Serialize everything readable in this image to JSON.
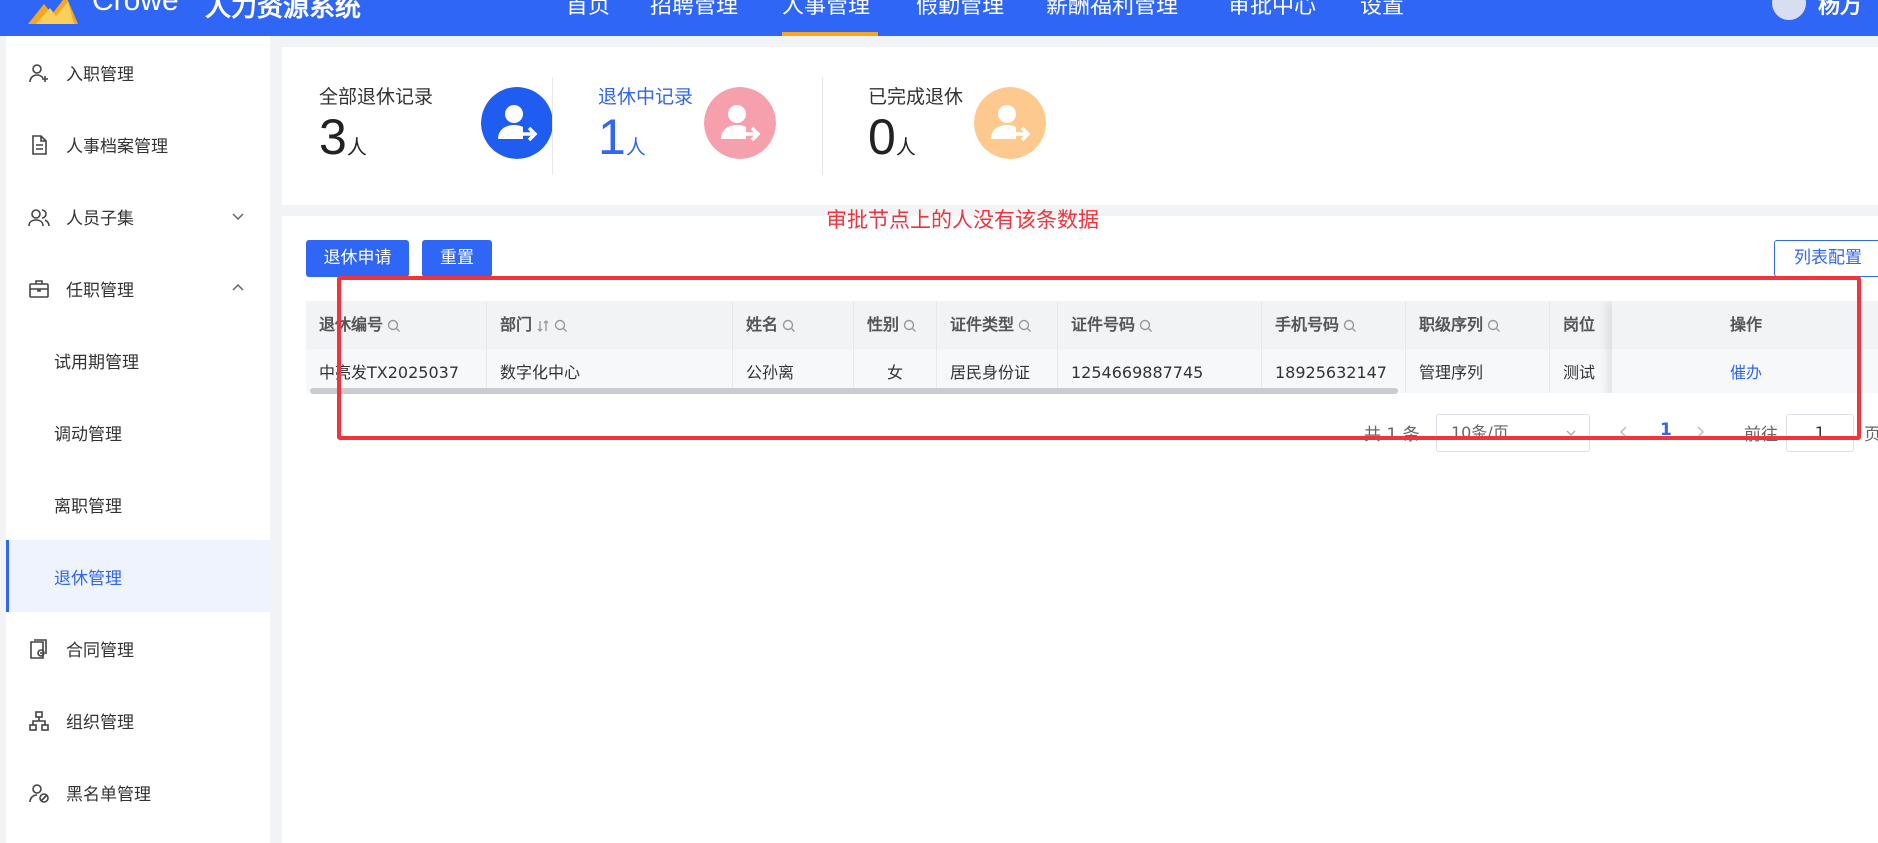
{
  "app": {
    "brand": "Crowe",
    "title": "人力资源系统"
  },
  "topnav": {
    "items": [
      "首页",
      "招聘管理",
      "人事管理",
      "假勤管理",
      "薪酬福利管理",
      "审批中心",
      "设置"
    ],
    "active": "人事管理",
    "user": "杨万"
  },
  "sidebar": {
    "items": [
      {
        "label": "入职管理"
      },
      {
        "label": "人事档案管理"
      },
      {
        "label": "人员子集"
      },
      {
        "label": "任职管理"
      },
      {
        "label": "试用期管理"
      },
      {
        "label": "调动管理"
      },
      {
        "label": "离职管理"
      },
      {
        "label": "退休管理"
      },
      {
        "label": "合同管理"
      },
      {
        "label": "组织管理"
      },
      {
        "label": "黑名单管理"
      }
    ],
    "active": "退休管理"
  },
  "stats": [
    {
      "label": "全部退休记录",
      "value": "3",
      "unit": "人",
      "color": "#1f5cf0"
    },
    {
      "label": "退休中记录",
      "value": "1",
      "unit": "人",
      "color": "#f7a0ad"
    },
    {
      "label": "已完成退休",
      "value": "0",
      "unit": "人",
      "color": "#fdc98e"
    }
  ],
  "annotation": "审批节点上的人没有该条数据",
  "toolbar": {
    "apply": "退休申请",
    "reset": "重置",
    "config": "列表配置"
  },
  "table": {
    "columns": [
      "退休编号",
      "部门",
      "姓名",
      "性别",
      "证件类型",
      "证件号码",
      "手机号码",
      "职级序列",
      "岗位"
    ],
    "action_column": "操作",
    "rows": [
      {
        "cells": [
          "中亮发TX2025037",
          "数字化中心",
          "公孙离",
          "女",
          "居民身份证",
          "1254669887745",
          "18925632147",
          "管理序列",
          "测试"
        ],
        "action": "催办"
      }
    ]
  },
  "pagination": {
    "total": "共 1 条",
    "page_size": "10条/页",
    "current": "1",
    "goto_label": "前往",
    "goto_value": "1",
    "goto_unit": "页"
  }
}
